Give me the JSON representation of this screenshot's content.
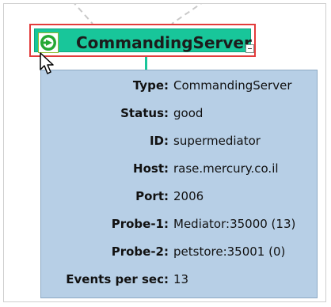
{
  "node": {
    "title": "CommandingServer",
    "icon": "server-status-icon",
    "collapse_icon": "collapse-icon"
  },
  "tooltip": {
    "rows": [
      {
        "label": "Type:",
        "value": "CommandingServer"
      },
      {
        "label": "Status:",
        "value": "good"
      },
      {
        "label": "ID:",
        "value": "supermediator"
      },
      {
        "label": "Host:",
        "value": "rase.mercury.co.il"
      },
      {
        "label": "Port:",
        "value": "2006"
      },
      {
        "label": "Probe-1:",
        "value": "Mediator:35000 (13)"
      },
      {
        "label": "Probe-2:",
        "value": "petstore:35001 (0)"
      },
      {
        "label": "Events per sec:",
        "value": "13"
      }
    ]
  },
  "colors": {
    "node_fill": "#18c69a",
    "selection_border": "#e23b3b",
    "tooltip_bg": "#b7cfe6"
  }
}
